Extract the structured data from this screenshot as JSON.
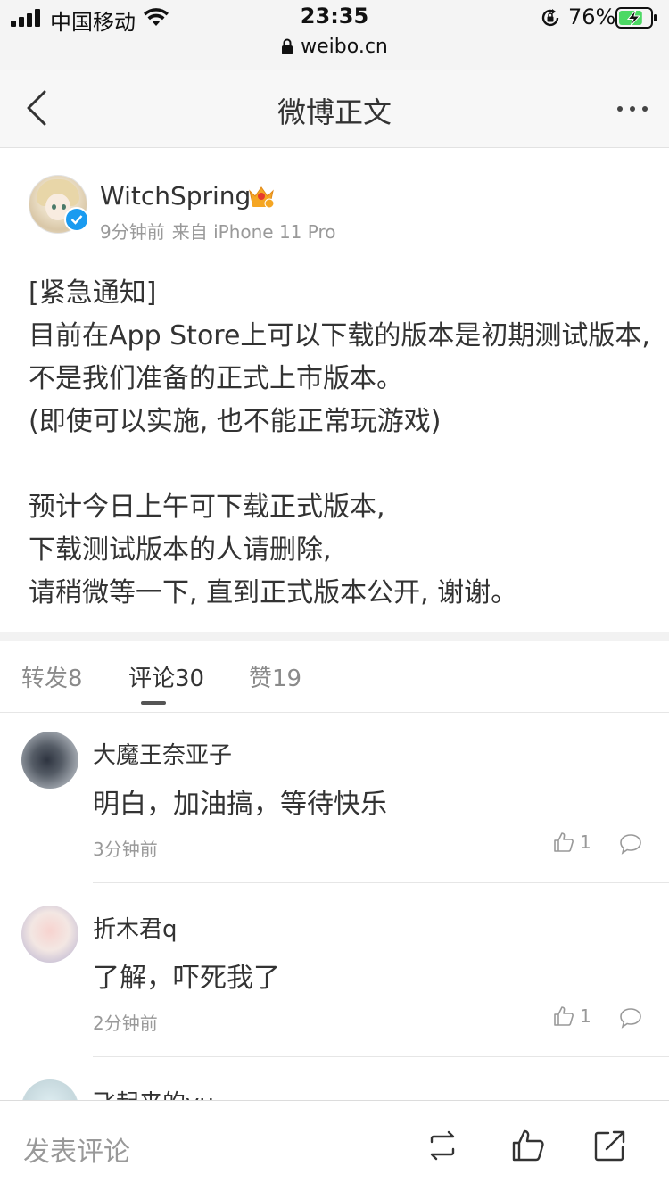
{
  "status_bar": {
    "carrier": "中国移动",
    "time": "23:35",
    "url": "weibo.cn",
    "battery_percent": "76%",
    "battery_level": 0.76,
    "icons": [
      "signal-icon",
      "wifi-icon",
      "lock-icon",
      "rotation-lock-icon",
      "battery-charging-icon"
    ]
  },
  "nav": {
    "title": "微博正文",
    "icons": [
      "back-arrow-icon",
      "more-icon"
    ]
  },
  "post": {
    "username": "WitchSpring",
    "time_ago": "9分钟前",
    "source": "来自 iPhone 11 Pro",
    "badges": [
      "verified-icon",
      "vip-crown-icon"
    ],
    "paragraphs": [
      "[紧急通知]",
      "目前在App Store上可以下载的版本是初期测试版本, 不是我们准备的正式上市版本。",
      "(即使可以实施, 也不能正常玩游戏)",
      "",
      "预计今日上午可下载正式版本,",
      "下载测试版本的人请删除,",
      "请稍微等一下, 直到正式版本公开, 谢谢。"
    ]
  },
  "tabs": [
    {
      "label": "转发8",
      "active": false
    },
    {
      "label": "评论30",
      "active": true
    },
    {
      "label": "赞19",
      "active": false
    }
  ],
  "comments": [
    {
      "username": "大魔王奈亚子",
      "text": "明白，加油搞，等待快乐",
      "time": "3分钟前",
      "likes": "1"
    },
    {
      "username": "折木君q",
      "text": "了解，吓死我了",
      "time": "2分钟前",
      "likes": "1"
    },
    {
      "username": "飞起来的yu",
      "text": "",
      "time": "",
      "likes": ""
    }
  ],
  "bottom_bar": {
    "comment_placeholder": "发表评论",
    "icons": [
      "repost-icon",
      "like-icon",
      "share-icon"
    ]
  },
  "colors": {
    "verified_blue": "#1a9bf0",
    "crown_orange": "#f5a623",
    "battery_green": "#4cd964",
    "text_primary": "#333333",
    "text_secondary": "#999999"
  }
}
